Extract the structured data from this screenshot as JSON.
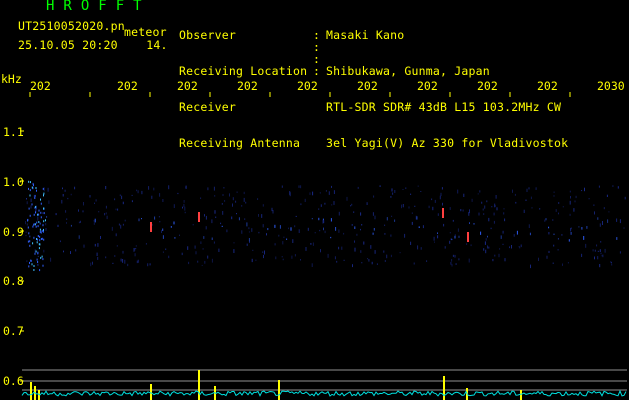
{
  "header": {
    "brand": "HROFFT",
    "file_name": "UT2510052020.pn",
    "meteor_label": "meteor",
    "date_time": "25.10.05 20:20",
    "count": "14.",
    "fields": [
      {
        "label": "Observer",
        "value": "Masaki Kano"
      },
      {
        "label": "Receiving Location",
        "value": "Shibukawa, Gunma, Japan"
      },
      {
        "label": "Receiver",
        "value": "RTL-SDR SDR# 43dB L15 103.2MHz CW"
      },
      {
        "label": "Receiving Antenna",
        "value": "3el Yagi(V) Az 330 for Vladivostok"
      }
    ]
  },
  "axes": {
    "y_unit": "kHz",
    "y_ticks": [
      "1.1",
      "1.0",
      "0.9",
      "0.8",
      "0.7",
      "0.6"
    ],
    "x_ticks": [
      "202",
      "202",
      "202",
      "202",
      "202",
      "202",
      "202",
      "202",
      "202",
      "2030"
    ]
  },
  "colors": {
    "text": "#ffff00",
    "brand": "#00ff00",
    "signal_low": "#1a2a8a",
    "signal_mid": "#3060ff",
    "signal_high": "#ff4040",
    "level_bars": "#ffff00",
    "noise_floor": "#00e0e0",
    "guide_lines": "#c0c0c0"
  }
}
